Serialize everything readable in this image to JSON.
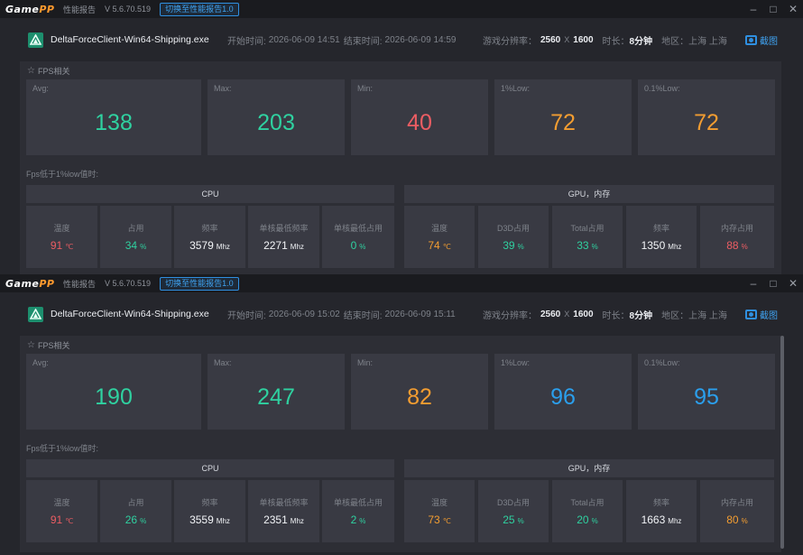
{
  "reports": [
    {
      "brand": {
        "game": "Game",
        "pp": "PP"
      },
      "title": "性能报告",
      "version": "V 5.6.70.519",
      "switch_label": "切换至性能报告1.0",
      "app_name": "DeltaForceClient-Win64-Shipping.exe",
      "start_label": "开始时间:",
      "start_time": "2026-06-09 14:51",
      "end_label": "结束时间:",
      "end_time": "2026-06-09 14:59",
      "res_label": "游戏分辨率：",
      "res_w": "2560",
      "res_x": "X",
      "res_h": "1600",
      "dur_label": "时长：",
      "duration": "8分钟",
      "region_label": "地区：",
      "region": "上海 上海",
      "screenshot_label": "截图",
      "fps_section": "FPS相关",
      "fps": [
        {
          "label": "Avg:",
          "value": "138",
          "color": "#2fd1a0"
        },
        {
          "label": "Max:",
          "value": "203",
          "color": "#2fd1a0"
        },
        {
          "label": "Min:",
          "value": "40",
          "color": "#ec5d63"
        },
        {
          "label": "1%Low:",
          "value": "72",
          "color": "#f39d31"
        },
        {
          "label": "0.1%Low:",
          "value": "72",
          "color": "#f39d31"
        }
      ],
      "low_label": "Fps低于1%low值时:",
      "cpu_head": "CPU",
      "gpu_head": "GPU，内存",
      "cpu": [
        {
          "label": "温度",
          "value": "91",
          "unit": "℃",
          "color": "#ec5d63"
        },
        {
          "label": "占用",
          "value": "34",
          "unit": "%",
          "color": "#2fd1a0"
        },
        {
          "label": "频率",
          "value": "3579",
          "unit": "Mhz",
          "color": "#f2f4f7"
        },
        {
          "label": "单核最低频率",
          "value": "2271",
          "unit": "Mhz",
          "color": "#f2f4f7"
        },
        {
          "label": "单核最低占用",
          "value": "0",
          "unit": "%",
          "color": "#2fd1a0"
        }
      ],
      "gpu": [
        {
          "label": "温度",
          "value": "74",
          "unit": "℃",
          "color": "#f39d31"
        },
        {
          "label": "D3D占用",
          "value": "39",
          "unit": "%",
          "color": "#2fd1a0"
        },
        {
          "label": "Total占用",
          "value": "33",
          "unit": "%",
          "color": "#2fd1a0"
        },
        {
          "label": "频率",
          "value": "1350",
          "unit": "Mhz",
          "color": "#f2f4f7"
        },
        {
          "label": "内存占用",
          "value": "88",
          "unit": "%",
          "color": "#ec5d63"
        }
      ]
    },
    {
      "brand": {
        "game": "Game",
        "pp": "PP"
      },
      "title": "性能报告",
      "version": "V 5.6.70.519",
      "switch_label": "切换至性能报告1.0",
      "app_name": "DeltaForceClient-Win64-Shipping.exe",
      "start_label": "开始时间:",
      "start_time": "2026-06-09 15:02",
      "end_label": "结束时间:",
      "end_time": "2026-06-09 15:11",
      "res_label": "游戏分辨率：",
      "res_w": "2560",
      "res_x": "X",
      "res_h": "1600",
      "dur_label": "时长：",
      "duration": "8分钟",
      "region_label": "地区：",
      "region": "上海 上海",
      "screenshot_label": "截图",
      "fps_section": "FPS相关",
      "fps": [
        {
          "label": "Avg:",
          "value": "190",
          "color": "#2fd1a0"
        },
        {
          "label": "Max:",
          "value": "247",
          "color": "#2fd1a0"
        },
        {
          "label": "Min:",
          "value": "82",
          "color": "#f39d31"
        },
        {
          "label": "1%Low:",
          "value": "96",
          "color": "#2b9fec"
        },
        {
          "label": "0.1%Low:",
          "value": "95",
          "color": "#2b9fec"
        }
      ],
      "low_label": "Fps低于1%low值时:",
      "cpu_head": "CPU",
      "gpu_head": "GPU，内存",
      "cpu": [
        {
          "label": "温度",
          "value": "91",
          "unit": "℃",
          "color": "#ec5d63"
        },
        {
          "label": "占用",
          "value": "26",
          "unit": "%",
          "color": "#2fd1a0"
        },
        {
          "label": "频率",
          "value": "3559",
          "unit": "Mhz",
          "color": "#f2f4f7"
        },
        {
          "label": "单核最低频率",
          "value": "2351",
          "unit": "Mhz",
          "color": "#f2f4f7"
        },
        {
          "label": "单核最低占用",
          "value": "2",
          "unit": "%",
          "color": "#2fd1a0"
        }
      ],
      "gpu": [
        {
          "label": "温度",
          "value": "73",
          "unit": "℃",
          "color": "#f39d31"
        },
        {
          "label": "D3D占用",
          "value": "25",
          "unit": "%",
          "color": "#2fd1a0"
        },
        {
          "label": "Total占用",
          "value": "20",
          "unit": "%",
          "color": "#2fd1a0"
        },
        {
          "label": "频率",
          "value": "1663",
          "unit": "Mhz",
          "color": "#f2f4f7"
        },
        {
          "label": "内存占用",
          "value": "80",
          "unit": "%",
          "color": "#f39d31"
        }
      ]
    }
  ]
}
